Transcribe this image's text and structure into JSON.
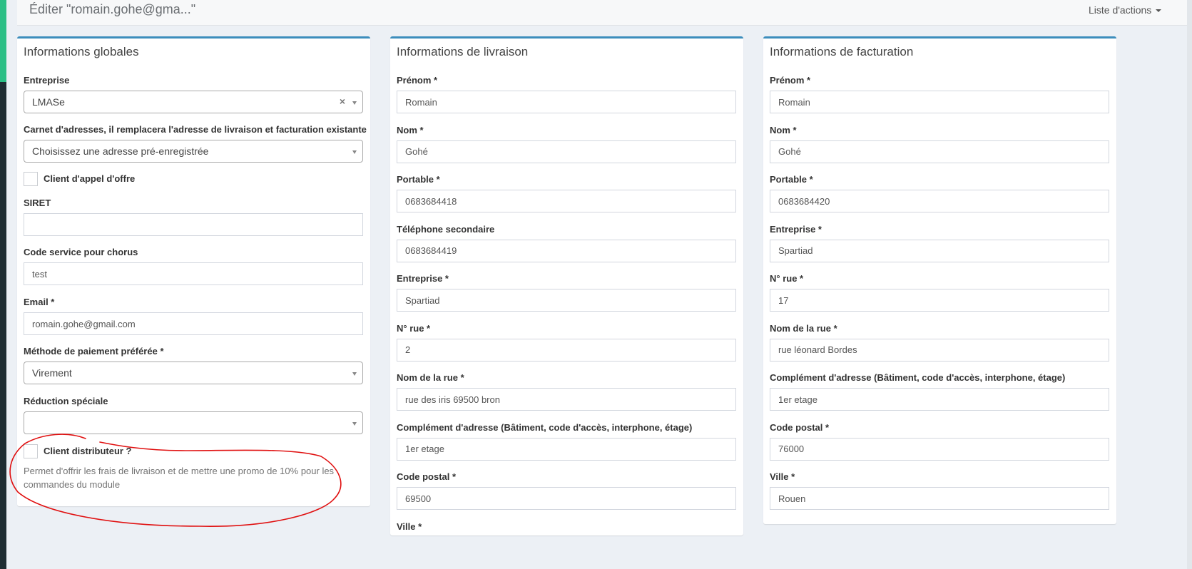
{
  "header": {
    "title": "Éditer \"romain.gohe@gma...\"",
    "actions_label": "Liste d'actions"
  },
  "globales": {
    "title": "Informations globales",
    "entreprise": {
      "label": "Entreprise",
      "value": "LMASe",
      "clear": "×"
    },
    "carnet": {
      "label": "Carnet d'adresses, il remplacera l'adresse de livraison et facturation existante",
      "placeholder": "Choisissez une adresse pré-enregistrée"
    },
    "appel_offre": {
      "label": "Client d'appel d'offre",
      "checked": false
    },
    "siret": {
      "label": "SIRET",
      "value": ""
    },
    "chorus": {
      "label": "Code service pour chorus",
      "value": "test"
    },
    "email": {
      "label": "Email *",
      "value": "romain.gohe@gmail.com"
    },
    "paiement": {
      "label": "Méthode de paiement préférée *",
      "value": "Virement"
    },
    "reduction": {
      "label": "Réduction spéciale",
      "value": ""
    },
    "distributeur": {
      "label": "Client distributeur ?",
      "checked": false,
      "help": "Permet d'offrir les frais de livraison et de mettre une promo de 10% pour les commandes du module"
    }
  },
  "livraison": {
    "title": "Informations de livraison",
    "fields": [
      {
        "label": "Prénom *",
        "value": "Romain"
      },
      {
        "label": "Nom *",
        "value": "Gohé"
      },
      {
        "label": "Portable *",
        "value": "0683684418"
      },
      {
        "label": "Téléphone secondaire",
        "value": "0683684419"
      },
      {
        "label": "Entreprise *",
        "value": "Spartiad"
      },
      {
        "label": "N° rue *",
        "value": "2"
      },
      {
        "label": "Nom de la rue *",
        "value": "rue des iris 69500 bron"
      },
      {
        "label": "Complément d'adresse (Bâtiment, code d'accès, interphone, étage)",
        "value": "1er etage"
      },
      {
        "label": "Code postal *",
        "value": "69500"
      },
      {
        "label": "Ville *",
        "value": ""
      }
    ]
  },
  "facturation": {
    "title": "Informations de facturation",
    "fields": [
      {
        "label": "Prénom *",
        "value": "Romain"
      },
      {
        "label": "Nom *",
        "value": "Gohé"
      },
      {
        "label": "Portable *",
        "value": "0683684420"
      },
      {
        "label": "Entreprise *",
        "value": "Spartiad"
      },
      {
        "label": "N° rue *",
        "value": "17"
      },
      {
        "label": "Nom de la rue *",
        "value": "rue léonard Bordes"
      },
      {
        "label": "Complément d'adresse (Bâtiment, code d'accès, interphone, étage)",
        "value": "1er etage"
      },
      {
        "label": "Code postal *",
        "value": "76000"
      },
      {
        "label": "Ville *",
        "value": "Rouen"
      }
    ]
  },
  "colors": {
    "accent": "#3c8dbc",
    "annotation": "#e01010",
    "sidebar": "#1f2d33",
    "sidebar_accent": "#2bbf86"
  }
}
